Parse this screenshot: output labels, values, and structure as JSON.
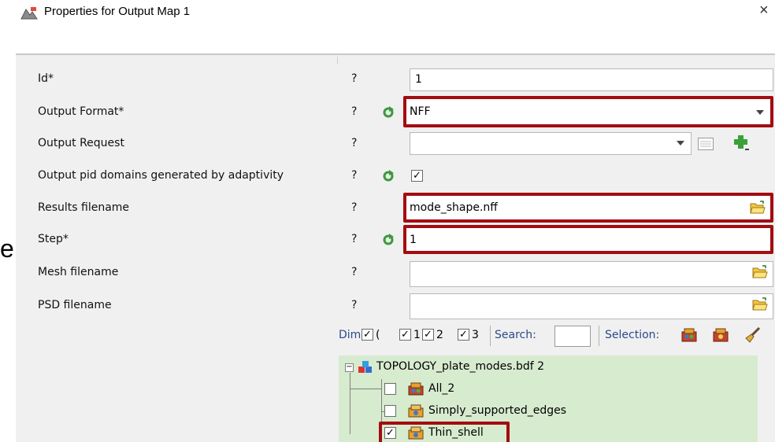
{
  "window": {
    "title": "Properties for Output Map 1",
    "close_glyph": "×",
    "icon": "map-app-icon"
  },
  "partial_left_char": "e",
  "rows": [
    {
      "label": "Id*",
      "help": "?",
      "value": "1"
    },
    {
      "label": "Output Format*",
      "help": "?",
      "value": "NFF"
    },
    {
      "label": "Output Request",
      "help": "?",
      "value": ""
    },
    {
      "label": "Output pid domains generated by adaptivity",
      "help": "?",
      "checked": "✓"
    },
    {
      "label": "Results filename",
      "help": "?",
      "value": "mode_shape.nff"
    },
    {
      "label": "Step*",
      "help": "?",
      "value": "1"
    },
    {
      "label": "Mesh filename",
      "help": "?",
      "value": ""
    },
    {
      "label": "PSD filename",
      "help": "?",
      "value": ""
    }
  ],
  "filter_bar": {
    "dim_label": "Dim",
    "dim_items": [
      {
        "checked": "✓",
        "text": "("
      },
      {
        "checked": "✓",
        "text": "1"
      },
      {
        "checked": "✓",
        "text": "2"
      },
      {
        "checked": "✓",
        "text": "3"
      }
    ],
    "search_label": "Search:",
    "search_value": "",
    "selection_label": "Selection:"
  },
  "tree": {
    "root": {
      "label": "TOPOLOGY_plate_modes.bdf 2",
      "expander": "−"
    },
    "children": [
      {
        "label": "All_2",
        "checked": ""
      },
      {
        "label": "Simply_supported_edges",
        "checked": ""
      },
      {
        "label": "Thin_shell",
        "checked": "✓"
      }
    ]
  },
  "colors": {
    "highlight": "#a30c11",
    "tree_background": "#d7ebcf",
    "panel_background": "#f0f0f0",
    "link_text": "#2a4a8a"
  }
}
